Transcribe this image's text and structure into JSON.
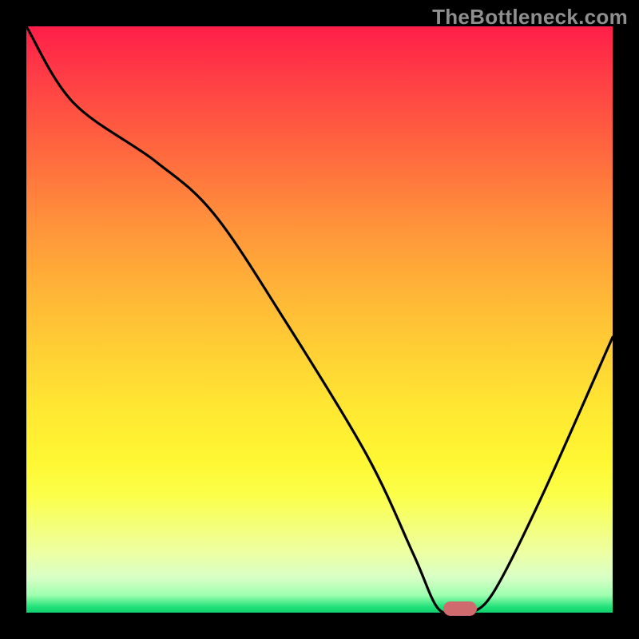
{
  "watermark": "TheBottleneck.com",
  "colors": {
    "background": "#000000",
    "gradient_top": "#ff1e48",
    "gradient_mid": "#ffd134",
    "gradient_bottom": "#0dd06f",
    "curve": "#000000",
    "marker": "#cf6a6e"
  },
  "chart_data": {
    "type": "line",
    "title": "",
    "xlabel": "",
    "ylabel": "",
    "xlim": [
      0,
      100
    ],
    "ylim": [
      0,
      100
    ],
    "series": [
      {
        "name": "bottleneck-curve",
        "x": [
          0,
          8,
          22,
          32,
          44,
          58,
          66,
          70,
          73,
          76,
          80,
          88,
          100
        ],
        "values": [
          100,
          87,
          77,
          68,
          50,
          27,
          10,
          1,
          0,
          0,
          4,
          20,
          47
        ]
      }
    ],
    "optimum_marker": {
      "x": 74,
      "y": 0
    },
    "annotations": []
  }
}
